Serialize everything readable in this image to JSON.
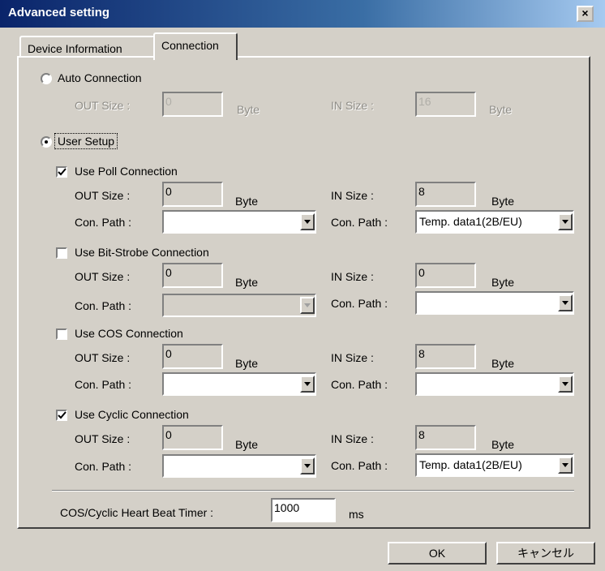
{
  "window": {
    "title": "Advanced setting",
    "close_glyph": "×"
  },
  "tabs": [
    "Device Information",
    "Connection"
  ],
  "auto": {
    "label": "Auto Connection",
    "out_label": "OUT Size :",
    "out_value": "0",
    "out_unit": "Byte",
    "in_label": "IN Size :",
    "in_value": "16",
    "in_unit": "Byte"
  },
  "user_setup": {
    "label": "User Setup"
  },
  "poll": {
    "label": "Use Poll Connection",
    "out_label": "OUT Size :",
    "out_value": "0",
    "out_unit": "Byte",
    "in_label": "IN Size :",
    "in_value": "8",
    "in_unit": "Byte",
    "out_path_label": "Con. Path :",
    "out_path_value": "",
    "in_path_label": "Con. Path :",
    "in_path_value": "Temp. data1(2B/EU)"
  },
  "bitstrobe": {
    "label": "Use Bit-Strobe Connection",
    "out_label": "OUT Size :",
    "out_value": "0",
    "out_unit": "Byte",
    "in_label": "IN Size :",
    "in_value": "0",
    "in_unit": "Byte",
    "out_path_label": "Con. Path :",
    "out_path_value": "",
    "in_path_label": "Con. Path :",
    "in_path_value": ""
  },
  "cos": {
    "label": "Use COS Connection",
    "out_label": "OUT Size :",
    "out_value": "0",
    "out_unit": "Byte",
    "in_label": "IN Size :",
    "in_value": "8",
    "in_unit": "Byte",
    "out_path_label": "Con. Path :",
    "out_path_value": "",
    "in_path_label": "Con. Path :",
    "in_path_value": ""
  },
  "cyclic": {
    "label": "Use Cyclic Connection",
    "out_label": "OUT Size :",
    "out_value": "0",
    "out_unit": "Byte",
    "in_label": "IN Size :",
    "in_value": "8",
    "in_unit": "Byte",
    "out_path_label": "Con. Path :",
    "out_path_value": "",
    "in_path_label": "Con. Path :",
    "in_path_value": "Temp. data1(2B/EU)"
  },
  "heartbeat": {
    "label": "COS/Cyclic Heart Beat Timer :",
    "value": "1000",
    "unit": "ms"
  },
  "buttons": {
    "ok": "OK",
    "cancel": "キャンセル"
  }
}
